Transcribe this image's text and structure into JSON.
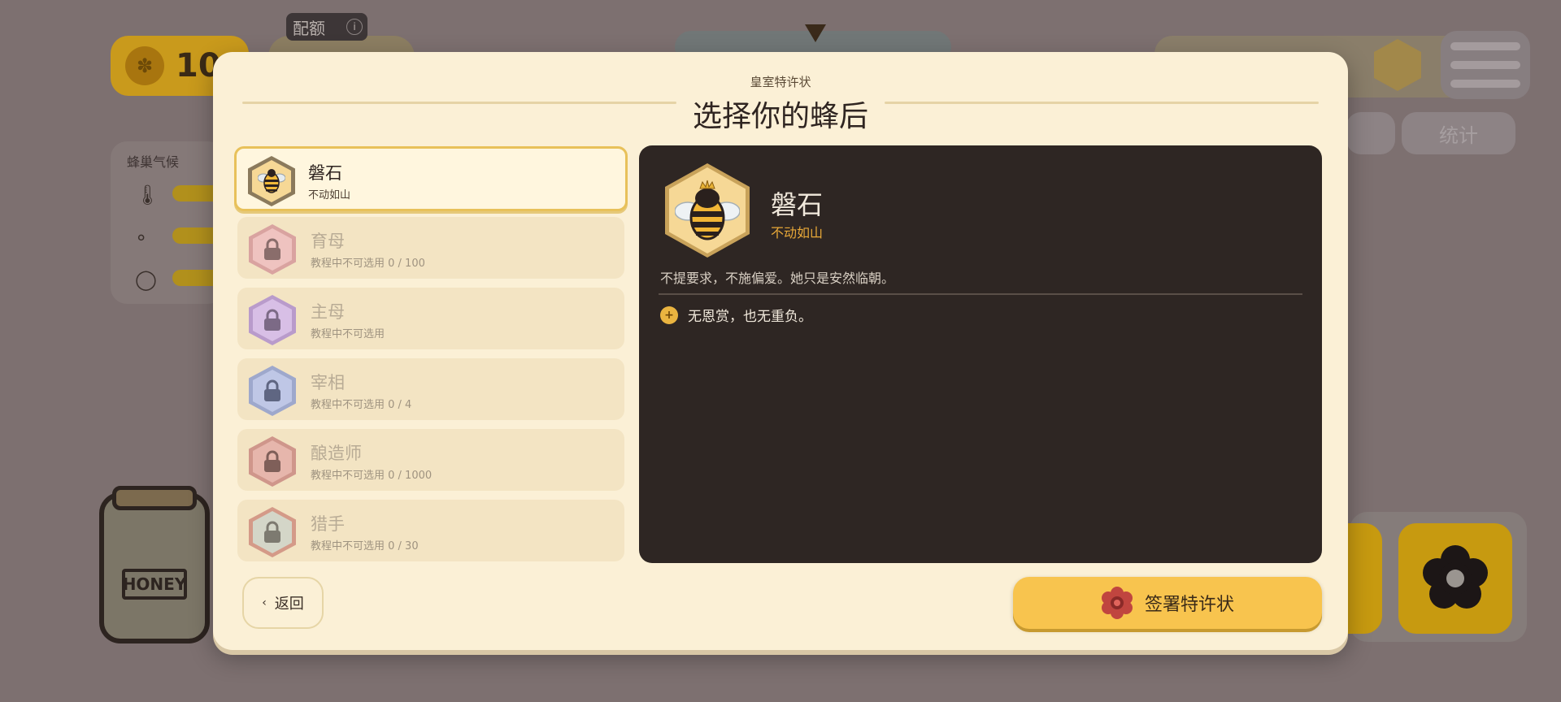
{
  "hud": {
    "coins": "10",
    "quota_label": "配额",
    "info_icon": "i",
    "climate_label": "蜂巢气候",
    "stats_label": "统计",
    "jar_label": "HONEY"
  },
  "modal": {
    "eyebrow": "皇室特许状",
    "title": "选择你的蜂后",
    "queens": [
      {
        "name": "磐石",
        "sub": "不动如山",
        "state": "selected",
        "color": "#f6d896"
      },
      {
        "name": "育母",
        "sub": "教程中不可选用 0 / 100",
        "state": "locked",
        "color": "#efb3b0"
      },
      {
        "name": "主母",
        "sub": "教程中不可选用",
        "state": "locked",
        "color": "#cdb0de"
      },
      {
        "name": "宰相",
        "sub": "教程中不可选用 0 / 4",
        "state": "locked",
        "color": "#b3bde2"
      },
      {
        "name": "酿造师",
        "sub": "教程中不可选用 0 / 1000",
        "state": "locked",
        "color": "#e0aaa0"
      },
      {
        "name": "猎手",
        "sub": "教程中不可选用 0 / 30",
        "state": "locked",
        "color": "#c9cdbf"
      }
    ],
    "detail": {
      "name": "磐石",
      "subtitle": "不动如山",
      "description": "不提要求，不施偏爱。她只是安然临朝。",
      "perk_icon": "+",
      "perk": "无恩赏，也无重负。"
    },
    "back_label": "返回",
    "back_icon": "‹",
    "sign_label": "签署特许状"
  },
  "colors": {
    "accent": "#f8c44e",
    "panel_dark": "#2e2623",
    "subtitle_orange": "#e8a838",
    "modal_bg": "#fbf0d6"
  }
}
